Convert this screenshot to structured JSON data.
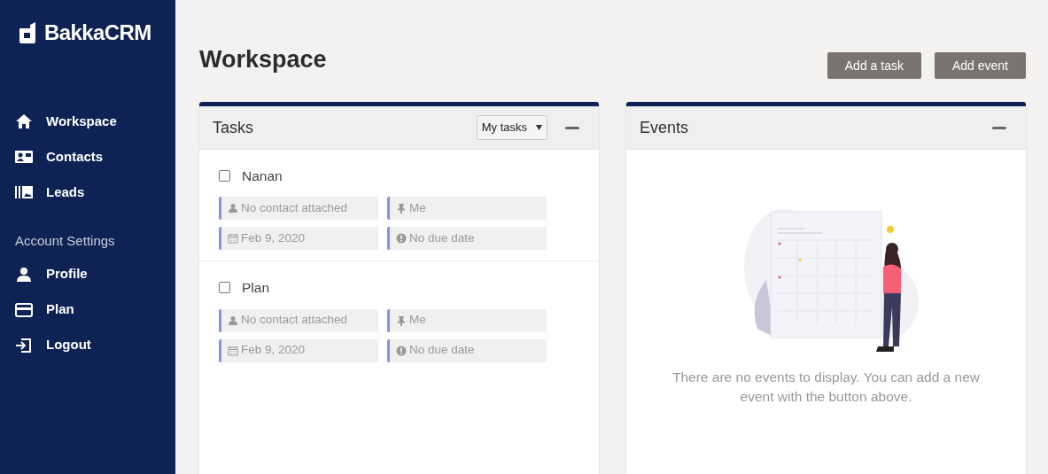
{
  "brand": "BakkaCRM",
  "nav": [
    {
      "label": "Workspace"
    },
    {
      "label": "Contacts"
    },
    {
      "label": "Leads"
    }
  ],
  "account_heading": "Account Settings",
  "account_nav": [
    {
      "label": "Profile"
    },
    {
      "label": "Plan"
    },
    {
      "label": "Logout"
    }
  ],
  "page_title": "Workspace",
  "buttons": [
    "Add a task",
    "Add event"
  ],
  "tasks_panel": {
    "title": "Tasks",
    "filter": "My tasks",
    "tasks": [
      {
        "title": "Nanan",
        "checked": false,
        "chips": [
          {
            "kind": "contact",
            "text": "No contact attached"
          },
          {
            "kind": "assignee",
            "text": "Me"
          },
          {
            "kind": "created",
            "text": "Feb 9, 2020"
          },
          {
            "kind": "due",
            "text": "No due date"
          }
        ]
      },
      {
        "title": "Plan",
        "checked": false,
        "chips": [
          {
            "kind": "contact",
            "text": "No contact attached"
          },
          {
            "kind": "assignee",
            "text": "Me"
          },
          {
            "kind": "created",
            "text": "Feb 9, 2020"
          },
          {
            "kind": "due",
            "text": "No due date"
          }
        ]
      }
    ]
  },
  "events_panel": {
    "title": "Events",
    "empty_message": "There are no events to display. You can add a new event with the button above."
  }
}
